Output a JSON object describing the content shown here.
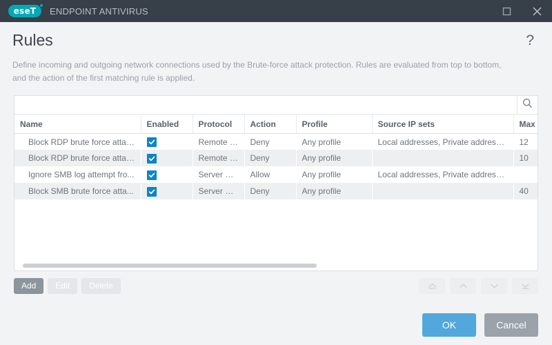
{
  "titlebar": {
    "logo_text": "eseT",
    "product_name": "ENDPOINT ANTIVIRUS",
    "maximize_icon": "square-icon",
    "close_icon": "close-icon"
  },
  "header": {
    "title": "Rules",
    "help_icon": "question-mark-icon",
    "help_label": "?"
  },
  "description": "Define incoming and outgoing network connections used by the Brute-force attack protection. Rules are evaluated from top to bottom, and the action of the first matching rule is applied.",
  "search": {
    "value": "",
    "placeholder": "",
    "icon": "search-icon"
  },
  "table": {
    "columns": [
      "Name",
      "Enabled",
      "Protocol",
      "Action",
      "Profile",
      "Source IP sets",
      "Max"
    ],
    "rows": [
      {
        "name": "Block RDP brute force attack...",
        "enabled": true,
        "protocol": "Remote De...",
        "action": "Deny",
        "profile": "Any profile",
        "source_ip_sets": "Local addresses, Private addresses",
        "max": "12"
      },
      {
        "name": "Block RDP brute force attack...",
        "enabled": true,
        "protocol": "Remote De...",
        "action": "Deny",
        "profile": "Any profile",
        "source_ip_sets": "",
        "max": "10"
      },
      {
        "name": "Ignore SMB log attempt fro...",
        "enabled": true,
        "protocol": "Server Mes...",
        "action": "Allow",
        "profile": "Any profile",
        "source_ip_sets": "Local addresses, Private addresses",
        "max": ""
      },
      {
        "name": "Block SMB brute force atta...",
        "enabled": true,
        "protocol": "Server Mes...",
        "action": "Deny",
        "profile": "Any profile",
        "source_ip_sets": "",
        "max": "40"
      }
    ],
    "checkbox_icon": "checkmark-icon",
    "scrollbar": "horizontal-scrollbar"
  },
  "toolbar": {
    "add_label": "Add",
    "edit_label": "Edit",
    "delete_label": "Delete",
    "move_top_icon": "move-to-top-icon",
    "move_up_icon": "move-up-icon",
    "move_down_icon": "move-down-icon",
    "move_bottom_icon": "move-to-bottom-icon"
  },
  "footer": {
    "ok_label": "OK",
    "cancel_label": "Cancel"
  },
  "colors": {
    "titlebar_bg": "#373f48",
    "logo_teal": "#00a9b5",
    "checkbox_blue": "#0d85c6",
    "ok_blue": "#52a7dc",
    "cancel_gray": "#9ba2a9",
    "page_bg": "#f2f3f5",
    "add_button_gray": "#8c949c"
  }
}
